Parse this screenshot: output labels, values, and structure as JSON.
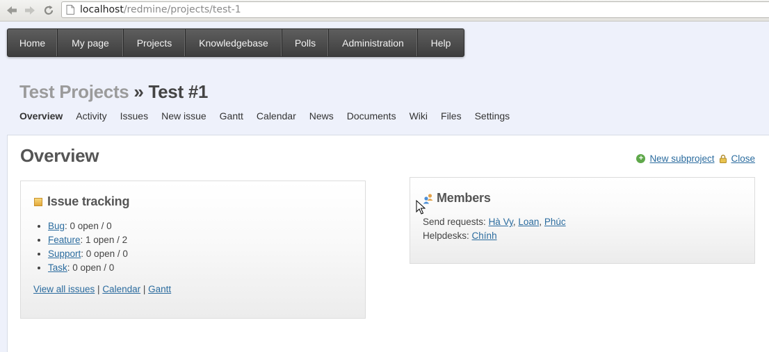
{
  "browser": {
    "url_host": "localhost",
    "url_path": "/redmine/projects/test-1"
  },
  "top_menu": [
    "Home",
    "My page",
    "Projects",
    "Knowledgebase",
    "Polls",
    "Administration",
    "Help"
  ],
  "header": {
    "parent_project": "Test Projects",
    "separator": " » ",
    "project": "Test #1"
  },
  "tabs": [
    "Overview",
    "Activity",
    "Issues",
    "New issue",
    "Gantt",
    "Calendar",
    "News",
    "Documents",
    "Wiki",
    "Files",
    "Settings"
  ],
  "main": {
    "heading": "Overview",
    "actions": {
      "new_subproject": "New subproject",
      "close": "Close"
    }
  },
  "issue_tracking": {
    "title": "Issue tracking",
    "trackers": [
      {
        "name": "Bug",
        "stats": ": 0 open / 0"
      },
      {
        "name": "Feature",
        "stats": ": 1 open / 2"
      },
      {
        "name": "Support",
        "stats": ": 0 open / 0"
      },
      {
        "name": "Task",
        "stats": ": 0 open / 0"
      }
    ],
    "links": {
      "view_all": "View all issues",
      "sep": " | ",
      "calendar": "Calendar",
      "gantt": "Gantt"
    }
  },
  "members": {
    "title": "Members",
    "send_requests_label": "Send requests: ",
    "send_requests": [
      "Hà Vy",
      "Loan",
      "Phúc"
    ],
    "comma": ", ",
    "helpdesks_label": "Helpdesks: ",
    "helpdesks": [
      "Chính"
    ]
  }
}
